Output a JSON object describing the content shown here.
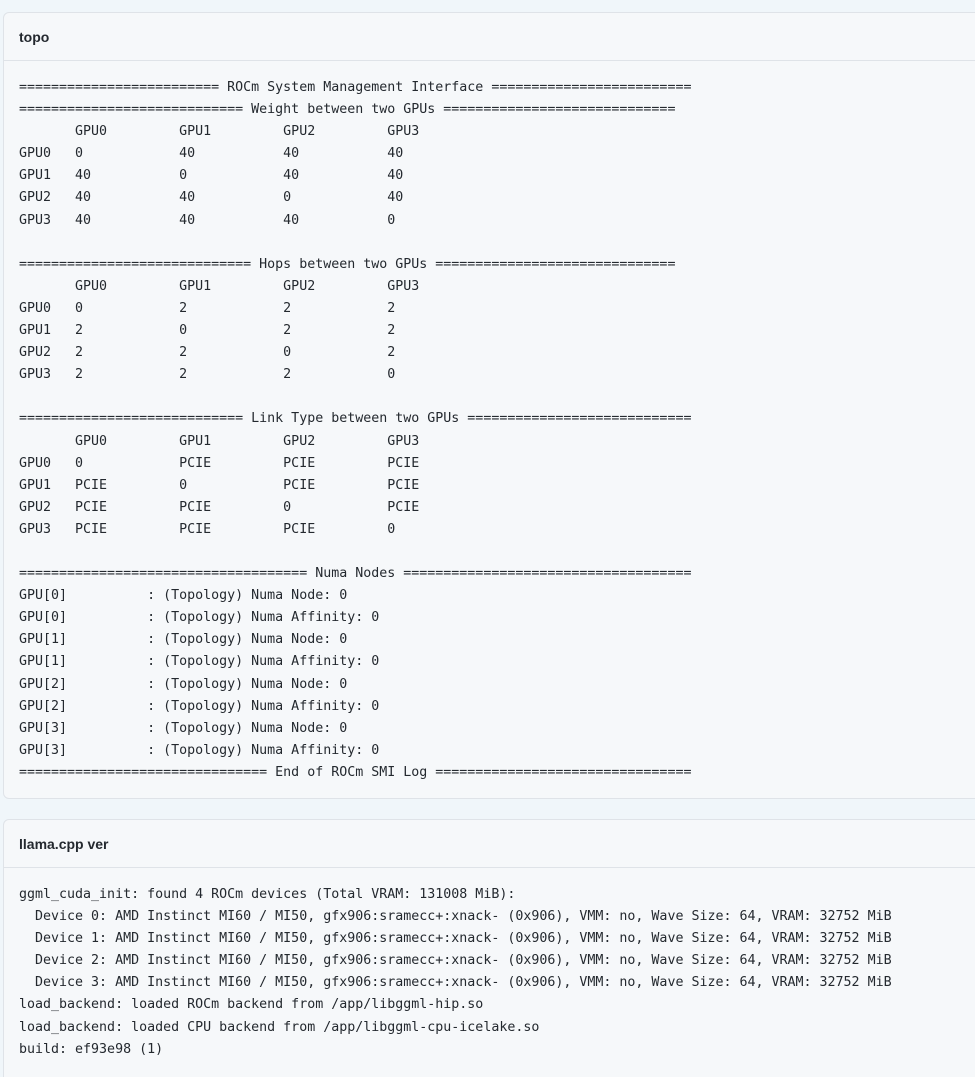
{
  "topo": {
    "title": "topo",
    "lines": [
      "========================= ROCm System Management Interface =========================",
      "============================ Weight between two GPUs =============================",
      "       GPU0         GPU1         GPU2         GPU3",
      "GPU0   0            40           40           40",
      "GPU1   40           0            40           40",
      "GPU2   40           40           0            40",
      "GPU3   40           40           40           0",
      "",
      "============================= Hops between two GPUs ==============================",
      "       GPU0         GPU1         GPU2         GPU3",
      "GPU0   0            2            2            2",
      "GPU1   2            0            2            2",
      "GPU2   2            2            0            2",
      "GPU3   2            2            2            0",
      "",
      "============================ Link Type between two GPUs ============================",
      "       GPU0         GPU1         GPU2         GPU3",
      "GPU0   0            PCIE         PCIE         PCIE",
      "GPU1   PCIE         0            PCIE         PCIE",
      "GPU2   PCIE         PCIE         0            PCIE",
      "GPU3   PCIE         PCIE         PCIE         0",
      "",
      "==================================== Numa Nodes ====================================",
      "GPU[0]          : (Topology) Numa Node: 0",
      "GPU[0]          : (Topology) Numa Affinity: 0",
      "GPU[1]          : (Topology) Numa Node: 0",
      "GPU[1]          : (Topology) Numa Affinity: 0",
      "GPU[2]          : (Topology) Numa Node: 0",
      "GPU[2]          : (Topology) Numa Affinity: 0",
      "GPU[3]          : (Topology) Numa Node: 0",
      "GPU[3]          : (Topology) Numa Affinity: 0",
      "=============================== End of ROCm SMI Log ================================"
    ]
  },
  "llama": {
    "title": "llama.cpp ver",
    "lines": [
      "ggml_cuda_init: found 4 ROCm devices (Total VRAM: 131008 MiB):",
      "  Device 0: AMD Instinct MI60 / MI50, gfx906:sramecc+:xnack- (0x906), VMM: no, Wave Size: 64, VRAM: 32752 MiB",
      "  Device 1: AMD Instinct MI60 / MI50, gfx906:sramecc+:xnack- (0x906), VMM: no, Wave Size: 64, VRAM: 32752 MiB",
      "  Device 2: AMD Instinct MI60 / MI50, gfx906:sramecc+:xnack- (0x906), VMM: no, Wave Size: 64, VRAM: 32752 MiB",
      "  Device 3: AMD Instinct MI60 / MI50, gfx906:sramecc+:xnack- (0x906), VMM: no, Wave Size: 64, VRAM: 32752 MiB",
      "load_backend: loaded ROCm backend from /app/libggml-hip.so",
      "load_backend: loaded CPU backend from /app/libggml-cpu-icelake.so",
      "build: ef93e98 (1)"
    ]
  }
}
